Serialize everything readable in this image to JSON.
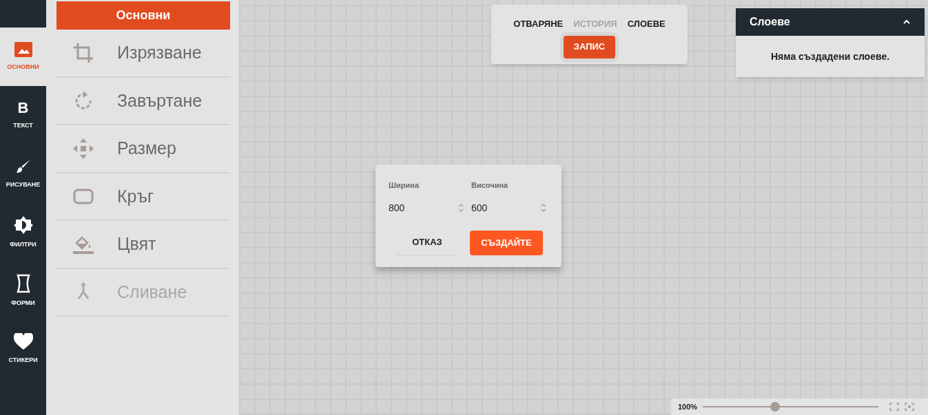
{
  "rail": [
    {
      "kind": "image",
      "label": "ОСНОВНИ",
      "selected": true
    },
    {
      "kind": "text",
      "glyph": "B",
      "label": "ТЕКСТ",
      "selected": false
    },
    {
      "kind": "brush",
      "label": "РИСУВАНЕ",
      "selected": false
    },
    {
      "kind": "filter",
      "label": "ФИЛТРИ",
      "selected": false
    },
    {
      "kind": "shape",
      "label": "ФОРМИ",
      "selected": false
    },
    {
      "kind": "heart",
      "label": "СТИКЕРИ",
      "selected": false
    }
  ],
  "panel": {
    "title": "Основни",
    "tools": [
      {
        "kind": "crop",
        "label": "Изрязване",
        "disabled": false
      },
      {
        "kind": "rotate",
        "label": "Завъртане",
        "disabled": false
      },
      {
        "kind": "resize",
        "label": "Размер",
        "disabled": false
      },
      {
        "kind": "round",
        "label": "Кръг",
        "disabled": false
      },
      {
        "kind": "fill",
        "label": "Цвят",
        "disabled": false
      },
      {
        "kind": "merge",
        "label": "Сливане",
        "disabled": true
      }
    ]
  },
  "top_menu": {
    "items": [
      {
        "label": "ОТВАРЯНЕ",
        "disabled": false
      },
      {
        "label": "ИСТОРИЯ",
        "disabled": true
      },
      {
        "label": "СЛОЕВЕ",
        "disabled": false
      }
    ],
    "save_button": "ЗАПИС"
  },
  "layers_panel": {
    "title": "Слоеве",
    "expanded": true,
    "empty_text": "Няма създадени слоеве."
  },
  "dialog": {
    "fields": [
      {
        "label": "Ширина",
        "value": "800"
      },
      {
        "label": "Височина",
        "value": "600"
      }
    ],
    "cancel_button": "ОТКАЗ",
    "create_button": "СЪЗДАЙТЕ"
  },
  "zoom": {
    "label": "100%",
    "level": 0.41
  }
}
